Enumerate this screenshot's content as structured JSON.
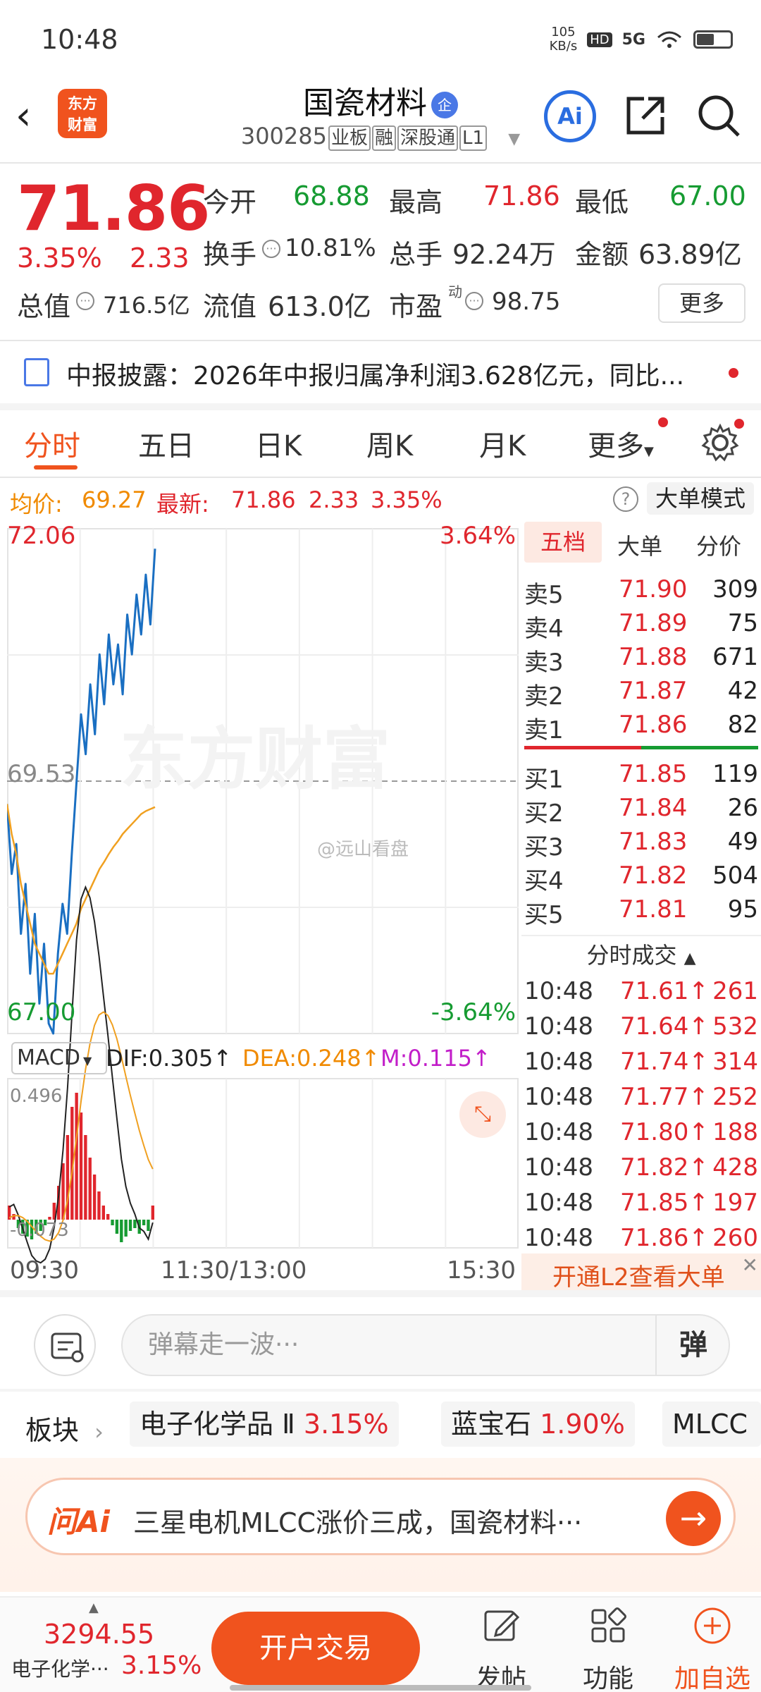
{
  "status_bar": {
    "time": "10:48",
    "net_speed": "105",
    "net_unit": "KB/s",
    "hd": "HD",
    "signal": "5G"
  },
  "header": {
    "back": "‹",
    "logo_line1": "东方",
    "logo_line2": "财富",
    "name": "国瓷材料",
    "name_badge": "企",
    "code": "300285",
    "tags": [
      "业板",
      "融",
      "深股通",
      "L1"
    ],
    "ai": "Ai"
  },
  "quote": {
    "price": "71.86",
    "change_pct": "3.35%",
    "change_amt": "2.33",
    "rows": [
      [
        {
          "label": "今开",
          "value": "68.88",
          "color": "#169b32"
        },
        {
          "label": "最高",
          "value": "71.86",
          "color": "#e0262d"
        },
        {
          "label": "最低",
          "value": "67.00",
          "color": "#169b32"
        }
      ],
      [
        {
          "label": "换手",
          "value": "10.81%",
          "color": "#333333"
        },
        {
          "label": "总手",
          "value": "92.24万",
          "color": "#333333"
        },
        {
          "label": "金额",
          "value": "63.89亿",
          "color": "#333333"
        }
      ],
      [
        {
          "label": "总值",
          "value": "716.5亿",
          "color": "#333333"
        },
        {
          "label": "流值",
          "value": "613.0亿",
          "color": "#333333"
        },
        {
          "label": "市盈",
          "value": "98.75",
          "color": "#333333"
        }
      ]
    ],
    "pe_sup": "动",
    "more": "更多"
  },
  "notice": {
    "text": "中报披露：2026年中报归属净利润3.628亿元，同比..."
  },
  "tabs": [
    "分时",
    "五日",
    "日K",
    "周K",
    "月K",
    "更多"
  ],
  "avg_row": {
    "avg_label": "均价:",
    "avg_value": "69.27",
    "latest_label": "最新:",
    "latest_value": "71.86",
    "change_amt": "2.33",
    "change_pct": "3.35%",
    "help": "?",
    "big_order_mode": "大单模式"
  },
  "chart_data": {
    "type": "line",
    "title": "",
    "y_top_label": "72.06",
    "y_mid_label": "69.53",
    "y_bottom_label": "67.00",
    "pct_top_label": "3.64%",
    "pct_bottom_label": "-3.64%",
    "ylim": [
      67.0,
      72.06
    ],
    "x_ticks": [
      "09:30",
      "11:30/13:00",
      "15:30"
    ],
    "watermark": "@远山看盘",
    "series": [
      {
        "color": "#1a6fc2",
        "values": [
          69.3,
          68.6,
          68.9,
          68.0,
          68.5,
          67.6,
          68.2,
          67.3,
          67.9,
          67.1,
          67.0,
          67.8,
          68.3,
          68.0,
          68.8,
          69.5,
          70.2,
          69.8,
          70.5,
          70.0,
          70.8,
          70.3,
          71.0,
          70.5,
          70.9,
          70.4,
          71.2,
          70.8,
          71.4,
          71.0,
          71.6,
          71.1,
          71.86
        ]
      },
      {
        "color": "#f0a020",
        "values": [
          69.3,
          69.0,
          68.8,
          68.5,
          68.3,
          68.1,
          67.9,
          67.8,
          67.7,
          67.6,
          67.6,
          67.7,
          67.8,
          67.9,
          68.0,
          68.1,
          68.25,
          68.35,
          68.45,
          68.55,
          68.65,
          68.72,
          68.8,
          68.87,
          68.93,
          69.0,
          69.05,
          69.1,
          69.15,
          69.2,
          69.23,
          69.25,
          69.27
        ]
      }
    ],
    "macd": {
      "label": "MACD",
      "dif_label": "DIF:0.305",
      "dea_label": "DEA:0.248",
      "m_label": "M:0.115",
      "y_top": "0.496",
      "y_bottom": "-0.073",
      "hist": [
        0.05,
        0.02,
        -0.03,
        -0.05,
        -0.06,
        -0.07,
        -0.05,
        -0.04,
        -0.02,
        0.01,
        0.06,
        0.12,
        0.2,
        0.3,
        0.4,
        0.45,
        0.38,
        0.3,
        0.22,
        0.16,
        0.1,
        0.05,
        0.02,
        -0.02,
        -0.05,
        -0.08,
        -0.06,
        -0.04,
        -0.03,
        -0.05,
        -0.02,
        -0.04,
        0.05
      ]
    }
  },
  "order_book": {
    "tabs": [
      "五档",
      "大单",
      "分价"
    ],
    "asks": [
      {
        "label": "卖5",
        "price": "71.90",
        "vol": "309"
      },
      {
        "label": "卖4",
        "price": "71.89",
        "vol": "75"
      },
      {
        "label": "卖3",
        "price": "71.88",
        "vol": "671"
      },
      {
        "label": "卖2",
        "price": "71.87",
        "vol": "42"
      },
      {
        "label": "卖1",
        "price": "71.86",
        "vol": "82"
      }
    ],
    "bids": [
      {
        "label": "买1",
        "price": "71.85",
        "vol": "119"
      },
      {
        "label": "买2",
        "price": "71.84",
        "vol": "26"
      },
      {
        "label": "买3",
        "price": "71.83",
        "vol": "49"
      },
      {
        "label": "买4",
        "price": "71.82",
        "vol": "504"
      },
      {
        "label": "买5",
        "price": "71.81",
        "vol": "95"
      }
    ],
    "trades_title": "分时成交",
    "trades": [
      {
        "time": "10:48",
        "price": "71.61↑",
        "vol": "261"
      },
      {
        "time": "10:48",
        "price": "71.64↑",
        "vol": "532"
      },
      {
        "time": "10:48",
        "price": "71.74↑",
        "vol": "314"
      },
      {
        "time": "10:48",
        "price": "71.77↑",
        "vol": "252"
      },
      {
        "time": "10:48",
        "price": "71.80↑",
        "vol": "188"
      },
      {
        "time": "10:48",
        "price": "71.82↑",
        "vol": "428"
      },
      {
        "time": "10:48",
        "price": "71.85↑",
        "vol": "197"
      },
      {
        "time": "10:48",
        "price": "71.86↑",
        "vol": "260"
      }
    ],
    "l2_promo": "开通L2查看大单"
  },
  "comment": {
    "placeholder": "弹幕走一波···",
    "danmu_btn": "弹"
  },
  "sectors": {
    "label": "板块",
    "chips": [
      {
        "name": "电子化学品 Ⅱ",
        "pct": "3.15%"
      },
      {
        "name": "蓝宝石",
        "pct": "1.90%"
      },
      {
        "name": "MLCC",
        "pct": ""
      }
    ]
  },
  "ask_ai": {
    "logo": "问Ai",
    "text": "三星电机MLCC涨价三成，国瓷材料···",
    "go": "→"
  },
  "bottom_nav": {
    "index_value": "3294.55",
    "index_name": "电子化学···",
    "index_pct": "3.15%",
    "trade_btn": "开户交易",
    "items": [
      "发帖",
      "功能",
      "加自选"
    ]
  }
}
